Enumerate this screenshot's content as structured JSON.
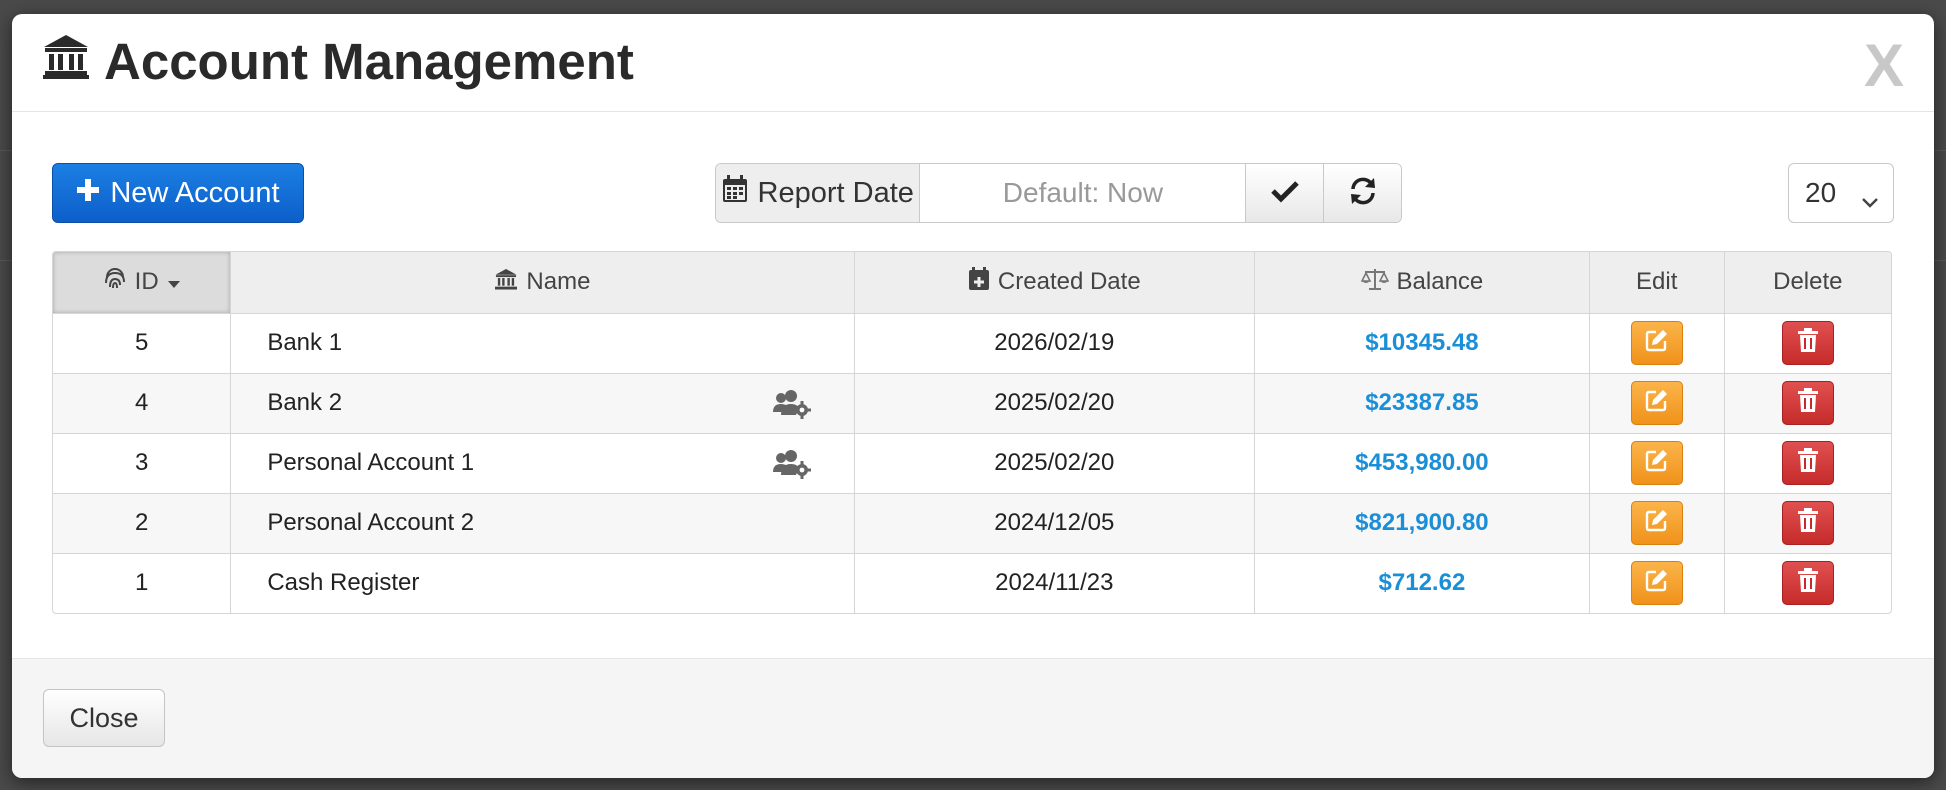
{
  "modal": {
    "title": "Account Management",
    "close_x": "X"
  },
  "toolbar": {
    "new_account_label": "New Account",
    "report_date_label": "Report Date",
    "date_placeholder": "Default: Now",
    "page_size": "20"
  },
  "table": {
    "headers": {
      "id": "ID",
      "name": "Name",
      "created_date": "Created Date",
      "balance": "Balance",
      "edit": "Edit",
      "delete": "Delete"
    },
    "rows": [
      {
        "id": "5",
        "name": "Bank 1",
        "shared": false,
        "created": "2026/02/19",
        "balance": "$10345.48"
      },
      {
        "id": "4",
        "name": "Bank 2",
        "shared": true,
        "created": "2025/02/20",
        "balance": "$23387.85"
      },
      {
        "id": "3",
        "name": "Personal Account 1",
        "shared": true,
        "created": "2025/02/20",
        "balance": "$453,980.00"
      },
      {
        "id": "2",
        "name": "Personal Account 2",
        "shared": false,
        "created": "2024/12/05",
        "balance": "$821,900.80"
      },
      {
        "id": "1",
        "name": "Cash Register",
        "shared": false,
        "created": "2024/11/23",
        "balance": "$712.62"
      }
    ]
  },
  "footer": {
    "close_label": "Close"
  },
  "colors": {
    "primary": "#0d5fc9",
    "balance": "#1a8fd8",
    "edit": "#f0921a",
    "delete": "#c62b2b"
  }
}
